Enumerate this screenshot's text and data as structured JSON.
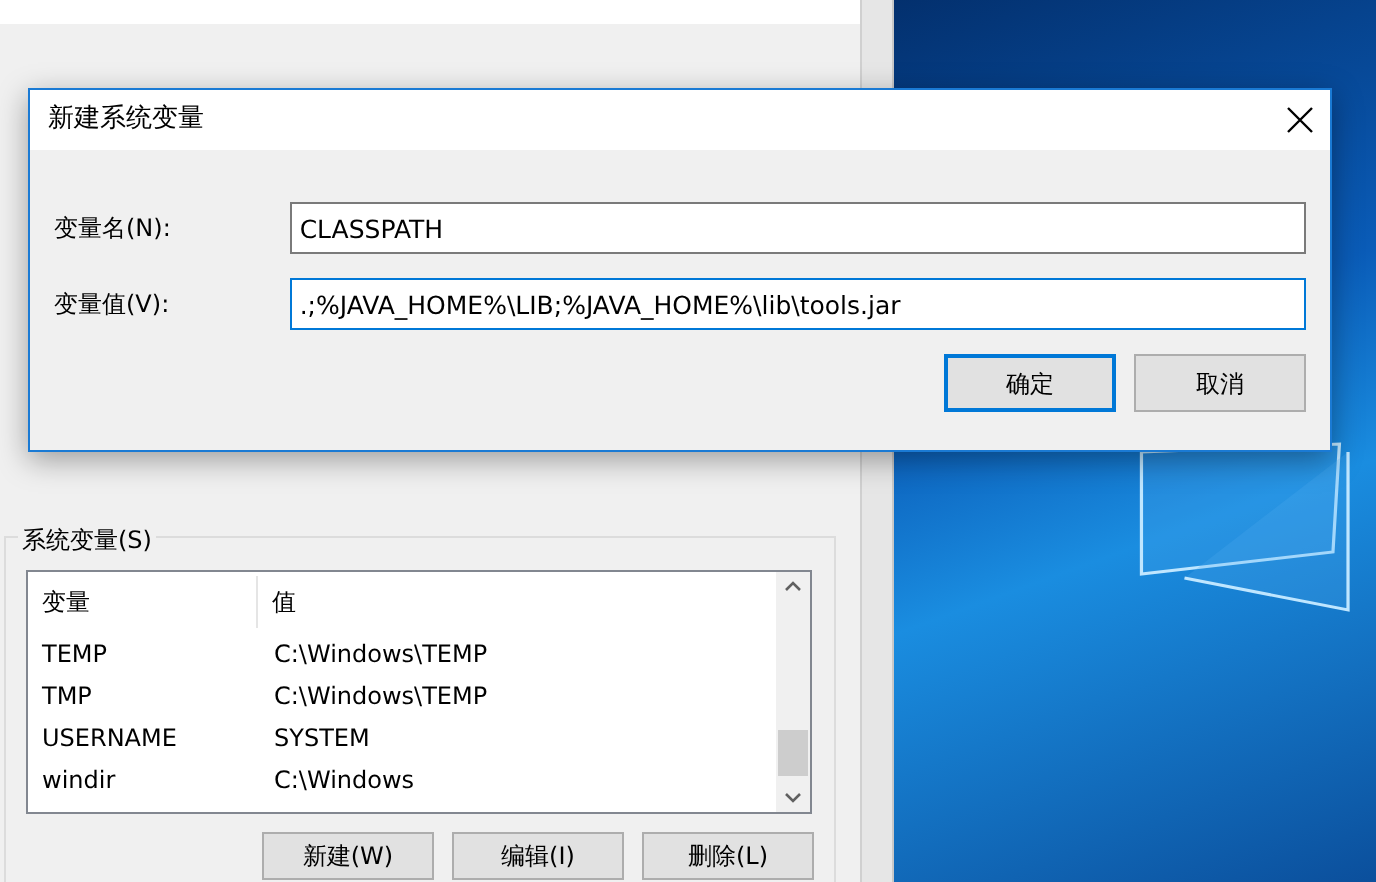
{
  "background_window": {
    "group_title": "系统变量(S)",
    "columns": [
      "变量",
      "值"
    ],
    "rows": [
      [
        "TEMP",
        "C:\\Windows\\TEMP"
      ],
      [
        "TMP",
        "C:\\Windows\\TEMP"
      ],
      [
        "USERNAME",
        "SYSTEM"
      ],
      [
        "windir",
        "C:\\Windows"
      ]
    ],
    "buttons": [
      "新建(W)",
      "编辑(I)",
      "删除(L)"
    ]
  },
  "dialog": {
    "title": "新建系统变量",
    "fields": [
      {
        "label": "变量名(N):",
        "value": "CLASSPATH",
        "focused": false
      },
      {
        "label": "变量值(V):",
        "value": ".;%JAVA_HOME%\\LIB;%JAVA_HOME%\\lib\\tools.jar",
        "focused": true
      }
    ],
    "buttons": [
      {
        "label": "确定",
        "default": true
      },
      {
        "label": "取消",
        "default": false
      }
    ]
  }
}
